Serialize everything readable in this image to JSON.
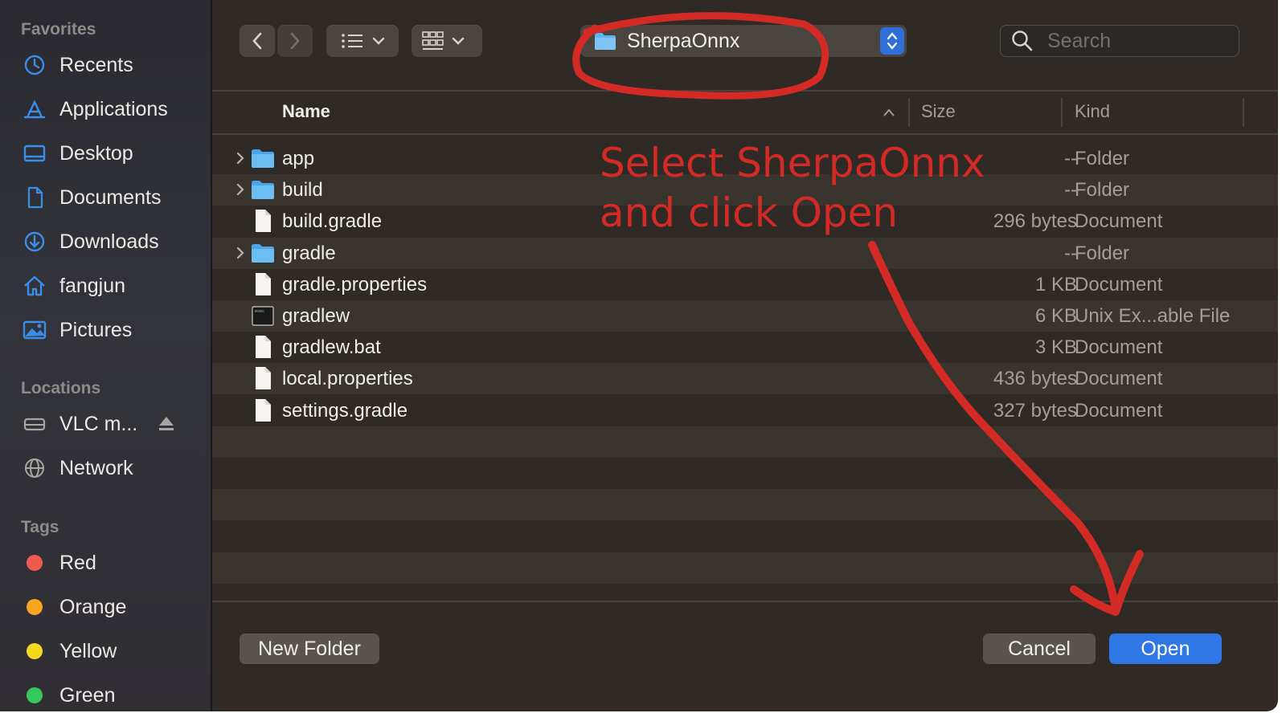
{
  "sidebar": {
    "favorites_label": "Favorites",
    "favorites": [
      {
        "label": "Recents",
        "icon": "clock-icon"
      },
      {
        "label": "Applications",
        "icon": "applications-icon"
      },
      {
        "label": "Desktop",
        "icon": "desktop-icon"
      },
      {
        "label": "Documents",
        "icon": "document-icon"
      },
      {
        "label": "Downloads",
        "icon": "download-icon"
      },
      {
        "label": "fangjun",
        "icon": "home-icon"
      },
      {
        "label": "Pictures",
        "icon": "pictures-icon"
      }
    ],
    "locations_label": "Locations",
    "locations": [
      {
        "label": "VLC m...",
        "icon": "disk-icon"
      },
      {
        "label": "Network",
        "icon": "globe-icon"
      }
    ],
    "tags_label": "Tags",
    "tags": [
      {
        "label": "Red",
        "color": "#f25a4f"
      },
      {
        "label": "Orange",
        "color": "#f6a623"
      },
      {
        "label": "Yellow",
        "color": "#f4d81d"
      },
      {
        "label": "Green",
        "color": "#36c85a"
      }
    ]
  },
  "toolbar": {
    "current_folder": "SherpaOnnx",
    "search_placeholder": "Search"
  },
  "columns": {
    "name": "Name",
    "size": "Size",
    "kind": "Kind"
  },
  "files": [
    {
      "name": "app",
      "size": "--",
      "kind": "Folder",
      "type": "folder",
      "expandable": true
    },
    {
      "name": "build",
      "size": "--",
      "kind": "Folder",
      "type": "folder",
      "expandable": true
    },
    {
      "name": "build.gradle",
      "size": "296 bytes",
      "kind": "Document",
      "type": "document",
      "expandable": false
    },
    {
      "name": "gradle",
      "size": "--",
      "kind": "Folder",
      "type": "folder",
      "expandable": true
    },
    {
      "name": "gradle.properties",
      "size": "1 KB",
      "kind": "Document",
      "type": "document",
      "expandable": false
    },
    {
      "name": "gradlew",
      "size": "6 KB",
      "kind": "Unix Ex...able File",
      "type": "exec",
      "expandable": false
    },
    {
      "name": "gradlew.bat",
      "size": "3 KB",
      "kind": "Document",
      "type": "document",
      "expandable": false
    },
    {
      "name": "local.properties",
      "size": "436 bytes",
      "kind": "Document",
      "type": "document",
      "expandable": false
    },
    {
      "name": "settings.gradle",
      "size": "327 bytes",
      "kind": "Document",
      "type": "document",
      "expandable": false
    }
  ],
  "buttons": {
    "new_folder": "New Folder",
    "cancel": "Cancel",
    "open": "Open"
  },
  "annotation": {
    "line1": "Select SherpaOnnx",
    "line2": "and click Open",
    "color": "#d42a25"
  },
  "colors": {
    "accent": "#2f77e6",
    "background": "#2f2a26"
  }
}
